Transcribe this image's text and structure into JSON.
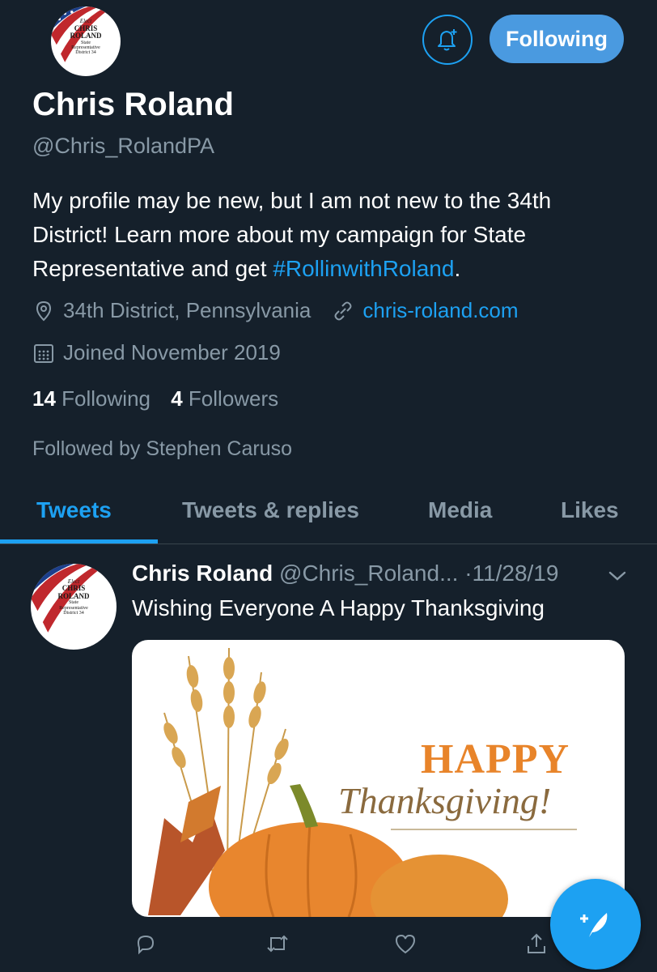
{
  "profile": {
    "name": "Chris Roland",
    "handle": "@Chris_RolandPA",
    "bio_prefix": "My profile may be new, but I am not new to the 34th District! Learn more about my campaign for State Representative and get ",
    "bio_hashtag": "#RollinwithRoland",
    "bio_suffix": ".",
    "location": "34th District, Pennsylvania",
    "website": "chris-roland.com",
    "joined": "Joined November 2019",
    "following_count": "14",
    "following_label": "Following",
    "followers_count": "4",
    "followers_label": "Followers",
    "followed_by": "Followed by Stephen Caruso"
  },
  "logo": {
    "line1": "Elect",
    "line2": "CHRIS",
    "line3": "ROLAND",
    "line4": "State",
    "line5": "Representative",
    "line6": "District 34"
  },
  "header": {
    "follow_button_label": "Following",
    "notify_icon": "bell-plus-icon"
  },
  "tabs": [
    {
      "label": "Tweets",
      "active": true
    },
    {
      "label": "Tweets & replies",
      "active": false
    },
    {
      "label": "Media",
      "active": false
    },
    {
      "label": "Likes",
      "active": false
    }
  ],
  "tweet": {
    "name": "Chris Roland",
    "handle": "@Chris_Roland...",
    "separator": "·",
    "date": "11/28/19",
    "text": "Wishing Everyone A Happy Thanksgiving",
    "image_text_1": "HAPPY",
    "image_text_2": "Thanksgiving!"
  },
  "colors": {
    "background": "#15202b",
    "accent": "#1da1f2",
    "secondary_text": "#8899a6"
  }
}
